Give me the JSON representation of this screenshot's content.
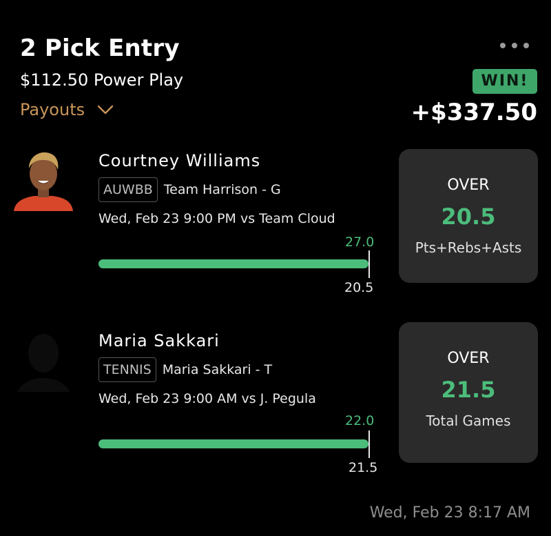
{
  "header": {
    "title": "2 Pick Entry",
    "subtitle": "$112.50 Power Play",
    "payouts_label": "Payouts",
    "result_badge": "WIN!",
    "result_amount": "+$337.50"
  },
  "picks": [
    {
      "player": "Courtney Williams",
      "league": "AUWBB",
      "team": "Team Harrison - G",
      "game": "Wed, Feb 23 9:00 PM vs Team Cloud",
      "actual": "27.0",
      "line": "20.5",
      "direction": "OVER",
      "card_value": "20.5",
      "stat": "Pts+Rebs+Asts"
    },
    {
      "player": "Maria Sakkari",
      "league": "TENNIS",
      "team": "Maria Sakkari - T",
      "game": "Wed, Feb 23 9:00 AM vs J. Pegula",
      "actual": "22.0",
      "line": "21.5",
      "direction": "OVER",
      "card_value": "21.5",
      "stat": "Total Games"
    }
  ],
  "timestamp": "Wed, Feb 23 8:17 AM",
  "colors": {
    "accent_gold": "#c8965a",
    "win_green": "#4cbc7b",
    "card_bg": "#2b2b2b"
  }
}
